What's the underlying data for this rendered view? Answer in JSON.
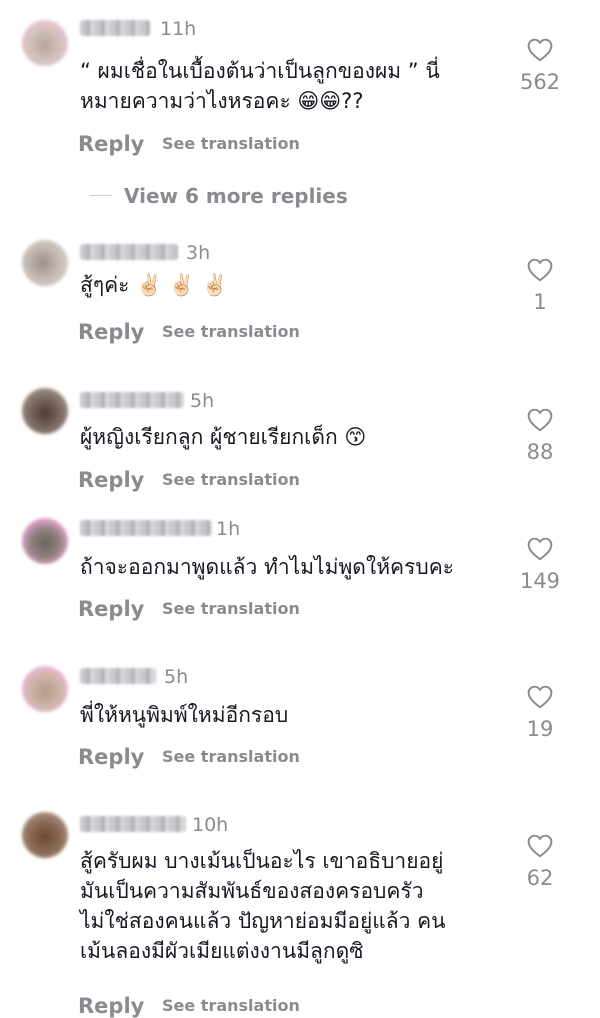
{
  "ui": {
    "reply_label": "Reply",
    "see_translation_label": "See translation",
    "view_more_replies": "View 6 more replies"
  },
  "comments": [
    {
      "time": "11h",
      "text": "“ ผมเชื่อในเบื้องต้นว่าเป็นลูกของผม ” นี่\nหมายความว่าไงหรอคะ 😁😁??",
      "likes": "562"
    },
    {
      "time": "3h",
      "text": "สู้ๆค่ะ ✌🏻 ✌🏻 ✌🏻",
      "likes": "1"
    },
    {
      "time": "5h",
      "text": "ผู้หญิงเรียกลูก ผู้ชายเรียกเด็ก 😙",
      "likes": "88"
    },
    {
      "time": "1h",
      "text": "ถ้าจะออกมาพูดแล้ว ทำไมไม่พูดให้ครบคะ",
      "likes": "149"
    },
    {
      "time": "5h",
      "text": "พี่ให้หนูพิมพ์ใหม่อีกรอบ",
      "likes": "19"
    },
    {
      "time": "10h",
      "text": "สู้ครับผม บางเม้นเป็นอะไร เขาอธิบายอยู่\nมันเป็นความสัมพันธ์ของสองครอบครัว\nไม่ใช่สองคนแล้ว ปัญหาย่อมมีอยู่แล้ว คน\nเม้นลองมีผัวเมียแต่งงานมีลูกดูซิ",
      "likes": "62"
    }
  ],
  "colors": {
    "text": "#161823",
    "muted": "#8a8b91",
    "background": "#ffffff"
  },
  "icons": {
    "like": "heart-outline-icon"
  }
}
